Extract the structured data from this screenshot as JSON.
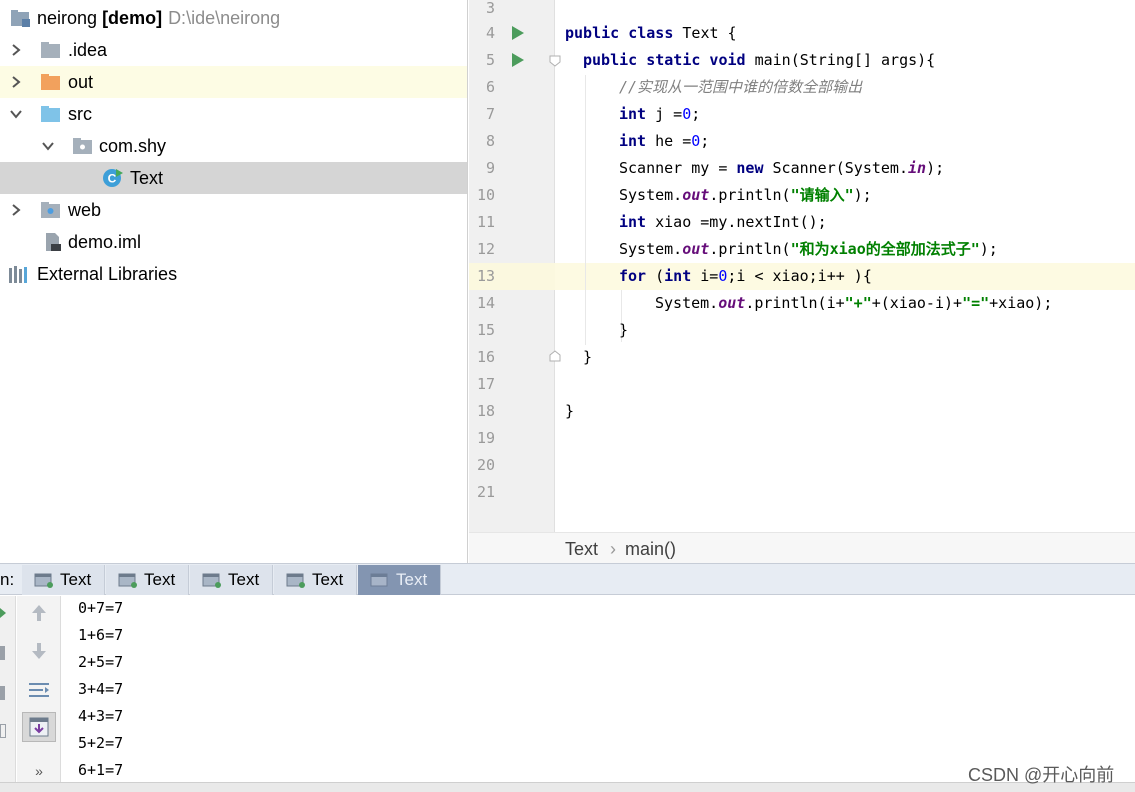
{
  "project": {
    "root_name": "neirong",
    "root_module": "[demo]",
    "root_path": "D:\\ide\\neirong",
    "items": [
      {
        "label": ".idea"
      },
      {
        "label": "out"
      },
      {
        "label": "src"
      },
      {
        "label": "com.shy"
      },
      {
        "label": "Text"
      },
      {
        "label": "web"
      },
      {
        "label": "demo.iml"
      },
      {
        "label": "External Libraries"
      }
    ]
  },
  "editor": {
    "line_numbers": [
      "3",
      "4",
      "5",
      "6",
      "7",
      "8",
      "9",
      "10",
      "11",
      "12",
      "13",
      "14",
      "15",
      "16",
      "17",
      "18",
      "19",
      "20",
      "21"
    ],
    "lines": {
      "l4": {
        "kw1": "public class",
        "rest": " Text {"
      },
      "l5": {
        "kw1": "public static void",
        "rest": " main(String[] args){"
      },
      "l6": {
        "comment": "//实现从一范围中谁的倍数全部输出"
      },
      "l7": {
        "kw1": "int",
        "rest1": " j =",
        "num": "0",
        "rest2": ";"
      },
      "l8": {
        "kw1": "int",
        "rest1": " he =",
        "num": "0",
        "rest2": ";"
      },
      "l9": {
        "rest1": "Scanner my = ",
        "kw1": "new",
        "rest2": " Scanner(System.",
        "field": "in",
        "rest3": ");"
      },
      "l10": {
        "rest1": "System.",
        "field": "out",
        "rest2": ".println(",
        "str": "\"请输入\"",
        "rest3": ");"
      },
      "l11": {
        "kw1": "int",
        "rest1": " xiao =my.nextInt();"
      },
      "l12": {
        "rest1": "System.",
        "field": "out",
        "rest2": ".println(",
        "str": "\"和为xiao的全部加法式子\"",
        "rest3": ");"
      },
      "l13": {
        "kw1": "for",
        "rest1": " (",
        "kw2": "int",
        "rest2": " i=",
        "num": "0",
        "rest3": ";i < xiao;i++ ){"
      },
      "l14": {
        "rest1": "System.",
        "field": "out",
        "rest2": ".println(i+",
        "str1": "\"+\"",
        "rest3": "+(xiao-i)+",
        "str2": "\"=\"",
        "rest4": "+xiao);"
      },
      "l15": {
        "rest1": "}"
      },
      "l16": {
        "rest1": "}"
      },
      "l18": {
        "rest1": "}"
      }
    }
  },
  "breadcrumb": {
    "class": "Text",
    "separator": "›",
    "method": "main()"
  },
  "run": {
    "label": "n:",
    "tabs": [
      "Text",
      "Text",
      "Text",
      "Text",
      "Text"
    ]
  },
  "console": {
    "output": [
      "0+7=7",
      "1+6=7",
      "2+5=7",
      "3+4=7",
      "4+3=7",
      "5+2=7",
      "6+1=7"
    ]
  },
  "watermark": "CSDN @开心向前",
  "colors": {
    "keyword": "#000080",
    "string": "#008000",
    "field": "#660e7a",
    "number": "#0000ff",
    "comment": "#808080",
    "active_tab": "#8395b1",
    "current_line": "#fdfae2"
  }
}
